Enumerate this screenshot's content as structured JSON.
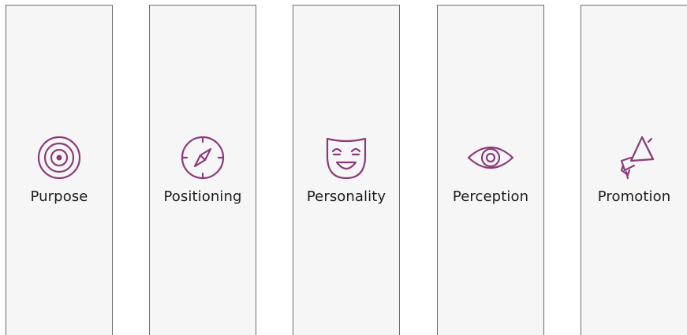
{
  "accent_color": "#8a3c7a",
  "panels": [
    {
      "label": "Purpose",
      "icon": "target-icon"
    },
    {
      "label": "Positioning",
      "icon": "compass-icon"
    },
    {
      "label": "Personality",
      "icon": "mask-icon"
    },
    {
      "label": "Perception",
      "icon": "eye-icon"
    },
    {
      "label": "Promotion",
      "icon": "megaphone-icon"
    }
  ]
}
